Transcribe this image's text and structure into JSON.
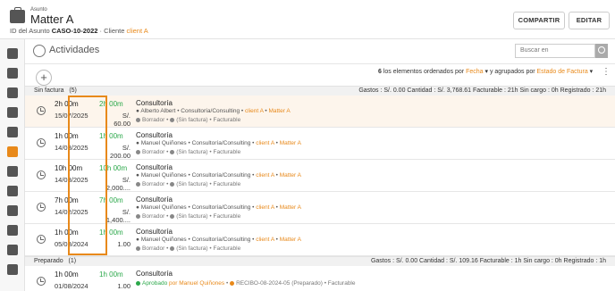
{
  "header": {
    "small_label": "Asunto",
    "title": "Matter A",
    "id_label": "ID del Asunto",
    "id_value": "CASO-10-2022",
    "client_label": "Cliente",
    "client_value": "client A",
    "share_label": "COMPARTIR",
    "edit_label": "EDITAR"
  },
  "activities": {
    "title": "Actividades",
    "search_placeholder": "Buscar en",
    "add_label": "+",
    "sort": {
      "count": "6",
      "text_a": "los elementos ordenados por",
      "sort_field": "Fecha",
      "text_b": "y agrupados por",
      "group_field": "Estado de Factura"
    }
  },
  "groups": [
    {
      "name": "Sin factura",
      "count": "(5)",
      "totals": "Gastos : S/. 0.00   Cantidad : S/. 3,768.61   Facturable : 21h   Sin cargo : 0h   Registrado : 21h"
    },
    {
      "name": "Preparado",
      "count": "(1)",
      "totals": "Gastos : S/. 0.00   Cantidad : S/. 109.16   Facturable : 1h   Sin cargo : 0h   Registrado : 1h"
    }
  ],
  "rows": [
    {
      "duration": "2h 00m",
      "date": "15/07/2025",
      "mark_time": "2h 00m",
      "mark_value": "S/. 60.00",
      "description": "Consultoría",
      "user": "Alberto Albert",
      "category": "Consultoría/Consulting",
      "client": "client A",
      "matter": "Matter A",
      "status": "Borrador",
      "invoice": "(Sin factura)",
      "billable": "Facturable"
    },
    {
      "duration": "1h 00m",
      "date": "14/03/2025",
      "mark_time": "1h 00m",
      "mark_value": "S/. 200.00",
      "description": "Consultoría",
      "user": "Manuel Quiñones",
      "category": "Consultoría/Consulting",
      "client": "client A",
      "matter": "Matter A",
      "status": "Borrador",
      "invoice": "(Sin factura)",
      "billable": "Facturable"
    },
    {
      "duration": "10h 00m",
      "date": "14/03/2025",
      "mark_time": "10h 00m",
      "mark_value": "S/. 2,000....",
      "description": "Consultoría",
      "user": "Manuel Quiñones",
      "category": "Consultoría/Consulting",
      "client": "client A",
      "matter": "Matter A",
      "status": "Borrador",
      "invoice": "(Sin factura)",
      "billable": "Facturable"
    },
    {
      "duration": "7h 00m",
      "date": "14/02/2025",
      "mark_time": "7h 00m",
      "mark_value": "S/. 1,400....",
      "description": "Consultoría",
      "user": "Manuel Quiñones",
      "category": "Consultoría/Consulting",
      "client": "client A",
      "matter": "Matter A",
      "status": "Borrador",
      "invoice": "(Sin factura)",
      "billable": "Facturable"
    },
    {
      "duration": "1h 00m",
      "date": "05/08/2024",
      "mark_time": "1h 00m",
      "mark_value": "1.00",
      "description": "Consultoría",
      "user": "Manuel Quiñones",
      "category": "Consultoría/Consulting",
      "client": "client A",
      "matter": "Matter A",
      "status": "Borrador",
      "invoice": "(Sin factura)",
      "billable": "Facturable"
    },
    {
      "duration": "1h 00m",
      "date": "01/08/2024",
      "mark_time": "1h 00m",
      "mark_value": "1.00",
      "description": "Consultoría",
      "user": "",
      "category": "",
      "client": "",
      "matter": "",
      "status": "Aprobado",
      "approved_by": "por Manuel Quiñones",
      "receipt": "RECIBO-08-2024-05 (Preparado)",
      "billable": "Facturable"
    }
  ],
  "colors": {
    "accent": "#e8891a",
    "success": "#2ba84a"
  }
}
